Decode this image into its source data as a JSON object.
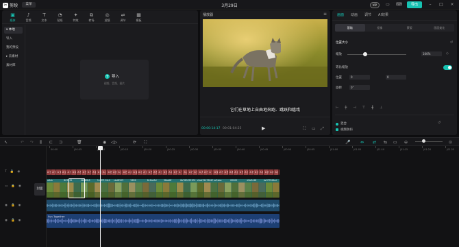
{
  "app": {
    "name": "剪映",
    "menu_label": "菜单",
    "project_title": "3月29日",
    "vip_label": "VIP",
    "export_label": "导出"
  },
  "media": {
    "tabs": [
      {
        "label": "媒体",
        "icon": "media-icon",
        "glyph": "▣"
      },
      {
        "label": "音频",
        "icon": "audio-icon",
        "glyph": "♪"
      },
      {
        "label": "文本",
        "icon": "text-icon",
        "glyph": "T"
      },
      {
        "label": "贴纸",
        "icon": "sticker-icon",
        "glyph": "◔"
      },
      {
        "label": "特效",
        "icon": "effects-icon",
        "glyph": "✦"
      },
      {
        "label": "转场",
        "icon": "transition-icon",
        "glyph": "⧉"
      },
      {
        "label": "滤镜",
        "icon": "filter-icon",
        "glyph": "◎"
      },
      {
        "label": "调节",
        "icon": "adjust-icon",
        "glyph": "⇌"
      },
      {
        "label": "模板",
        "icon": "template-icon",
        "glyph": "▦"
      }
    ],
    "sidebar": [
      "▾ 本地",
      "导入",
      "我的预设",
      "▸ 云素材",
      "素材库"
    ],
    "import_label": "导入",
    "import_hint": "视频、音频、图片"
  },
  "player": {
    "title": "播放器",
    "subtitle": "它们在草地上自由地奔跑、跳跃和嬉戏",
    "time_current": "00:00:14:17",
    "time_total": "00:01:04:25"
  },
  "props": {
    "tabs": [
      "画面",
      "动画",
      "调节",
      "AI效果"
    ],
    "subtabs": [
      "基础",
      "抠像",
      "蒙版",
      "画面美化"
    ],
    "section_title": "位置大小",
    "scale_label": "缩放",
    "scale_value": "100%",
    "uniform_label": "等比缩放",
    "pos_label": "位置",
    "pos_x": "0",
    "pos_y": "0",
    "rot_label": "旋转",
    "rot_value": "0°",
    "blend_label": "混合",
    "stabilize_label": "视频防抖",
    "accent": "#17c3b2"
  },
  "timeline": {
    "ruler": [
      "00:00",
      "|00:05",
      "|00:10",
      "|00:15",
      "|00:20",
      "|00:25",
      "|00:30",
      "|00:35",
      "|00:40",
      "|00:45",
      "|00:50",
      "|00:55",
      "|01:00",
      "|01:05",
      "|01:10",
      "|01:15",
      "|01:20",
      "|01:25"
    ],
    "cover_label": "封面",
    "subtitle_clips": [
      "A 它们在",
      "A 们在",
      "A 无垠",
      "A 这片",
      "A 在广",
      "A 绿意",
      "A 在这",
      "A 它们",
      "A 只",
      "A 面",
      "A 这",
      "A 小",
      "A 在",
      "A 展",
      "A 这",
      "A 在",
      "A 绿",
      "A 温",
      "A 小",
      "A 它",
      "A 在",
      "A 在",
      "A 无",
      "A 仿佛",
      "A 绿",
      "A 它们",
      "A 一",
      "A 大",
      "A 在",
      "A 它们",
      "A 大大",
      "A 在",
      "A 一",
      "A 如",
      "A 在",
      "A 在",
      "A 那",
      "A 自",
      "A 在",
      "A 它们",
      "A 在小",
      "A 其",
      "A 那",
      "A 其",
      "A 那在",
      "A 画"
    ],
    "main_labels": [
      "a6cb",
      "803235",
      "5696ffc2",
      "1cdf7114c4",
      "cbd8103",
      "2659",
      "8c1ba5d",
      "58ab8f",
      "8e780425301",
      "c9ed31476040504c14",
      "ec5aba",
      "00000",
      "d9e3c98",
      "de37f148cd"
    ],
    "audio_clip_label": "Fun Together"
  }
}
